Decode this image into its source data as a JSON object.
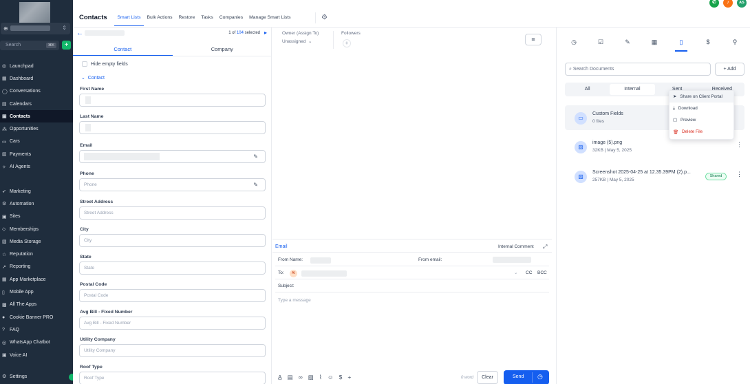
{
  "sidebar": {
    "search_placeholder": "Search",
    "search_kbd": "⌘K",
    "nav_top": [
      {
        "label": "Launchpad",
        "icon": "rocket-icon",
        "glyph": "◎"
      },
      {
        "label": "Dashboard",
        "icon": "dashboard-icon",
        "glyph": "▦"
      },
      {
        "label": "Conversations",
        "icon": "chat-icon",
        "glyph": "◯"
      },
      {
        "label": "Calendars",
        "icon": "calendar-icon",
        "glyph": "▤"
      },
      {
        "label": "Contacts",
        "icon": "contacts-icon",
        "glyph": "▣",
        "active": true
      },
      {
        "label": "Opportunities",
        "icon": "opportunities-icon",
        "glyph": "⁂"
      },
      {
        "label": "Cars",
        "icon": "car-icon",
        "glyph": "▭"
      },
      {
        "label": "Payments",
        "icon": "payments-icon",
        "glyph": "▥"
      },
      {
        "label": "AI Agents",
        "icon": "ai-agents-icon",
        "glyph": "✧"
      }
    ],
    "nav_bottom": [
      {
        "label": "Marketing",
        "icon": "marketing-icon",
        "glyph": "➶"
      },
      {
        "label": "Automation",
        "icon": "automation-icon",
        "glyph": "⚙"
      },
      {
        "label": "Sites",
        "icon": "sites-icon",
        "glyph": "▣"
      },
      {
        "label": "Memberships",
        "icon": "memberships-icon",
        "glyph": "◇"
      },
      {
        "label": "Media Storage",
        "icon": "media-storage-icon",
        "glyph": "▧"
      },
      {
        "label": "Reputation",
        "icon": "reputation-icon",
        "glyph": "☆"
      },
      {
        "label": "Reporting",
        "icon": "reporting-icon",
        "glyph": "↗"
      },
      {
        "label": "App Marketplace",
        "icon": "marketplace-icon",
        "glyph": "▦"
      },
      {
        "label": "Mobile App",
        "icon": "mobile-icon",
        "glyph": "▯"
      },
      {
        "label": "All The Apps",
        "icon": "apps-icon",
        "glyph": "▩"
      },
      {
        "label": "Cookie Banner PRO",
        "icon": "cookie-icon",
        "glyph": "●"
      },
      {
        "label": "FAQ",
        "icon": "faq-icon",
        "glyph": "?"
      },
      {
        "label": "WhatsApp Chatbot",
        "icon": "whatsapp-icon",
        "glyph": "◎"
      },
      {
        "label": "Voice AI",
        "icon": "voice-ai-icon",
        "glyph": "▣"
      }
    ],
    "settings_label": "Settings"
  },
  "topbar": {
    "title": "Contacts",
    "tabs": [
      "Smart Lists",
      "Bulk Actions",
      "Restore",
      "Tasks",
      "Companies",
      "Manage Smart Lists"
    ],
    "active_tab": "Smart Lists",
    "avatar_initials": "AS",
    "colors": {
      "phone": "#16a34a",
      "bell": "#f97316",
      "avatar": "#22a06b"
    }
  },
  "contact_panel": {
    "count_prefix": "1 of",
    "count_total": "104",
    "count_suffix": "selected",
    "tabs": [
      "Contact",
      "Company"
    ],
    "hide_empty_label": "Hide empty fields",
    "section_label": "Contact",
    "fields": [
      {
        "label": "First Name",
        "placeholder": ""
      },
      {
        "label": "Last Name",
        "placeholder": ""
      },
      {
        "label": "Email",
        "placeholder": ""
      },
      {
        "label": "Phone",
        "placeholder": "Phone"
      },
      {
        "label": "Street Address",
        "placeholder": "Street Address"
      },
      {
        "label": "City",
        "placeholder": "City"
      },
      {
        "label": "State",
        "placeholder": "State"
      },
      {
        "label": "Postal Code",
        "placeholder": "Postal Code"
      },
      {
        "label": "Avg Bill - Fixed Number",
        "placeholder": "Avg Bill - Fixed Number"
      },
      {
        "label": "Utility Company",
        "placeholder": "Utility Company"
      },
      {
        "label": "Roof Type",
        "placeholder": "Roof Type"
      }
    ]
  },
  "middle": {
    "owner_label": "Owner (Assign To)",
    "owner_value": "Unassigned",
    "followers_label": "Followers",
    "composer": {
      "tab_email": "Email",
      "internal_comment": "Internal Comment",
      "from_name_label": "From Name:",
      "from_email_label": "From email:",
      "to_label": "To:",
      "to_avatar": "AI",
      "cc": "CC",
      "bcc": "BCC",
      "subject_label": "Subject:",
      "message_placeholder": "Type a message",
      "word_count": "0 word",
      "clear_label": "Clear",
      "send_label": "Send"
    }
  },
  "documents": {
    "search_placeholder": "Search Documents",
    "add_label": "+ Add",
    "segments": [
      "All",
      "Internal",
      "Sent",
      "Received"
    ],
    "active_segment": "Internal",
    "items": [
      {
        "name": "Custom Fields",
        "meta": "0 files",
        "icon": "folder-icon"
      },
      {
        "name": "image (5).png",
        "meta": "32KB | May 5, 2025",
        "icon": "image-icon"
      },
      {
        "name": "Screenshot 2025-04-25 at 12.35.39PM (2).p...",
        "meta": "257KB | May 5, 2025",
        "icon": "image-icon",
        "badge": "Shared"
      }
    ],
    "context_menu": [
      {
        "label": "Share on Client Portal",
        "icon": "send-icon"
      },
      {
        "label": "Download",
        "icon": "download-icon"
      },
      {
        "label": "Preview",
        "icon": "preview-icon"
      },
      {
        "label": "Delete File",
        "icon": "trash-icon",
        "danger": true
      }
    ]
  }
}
